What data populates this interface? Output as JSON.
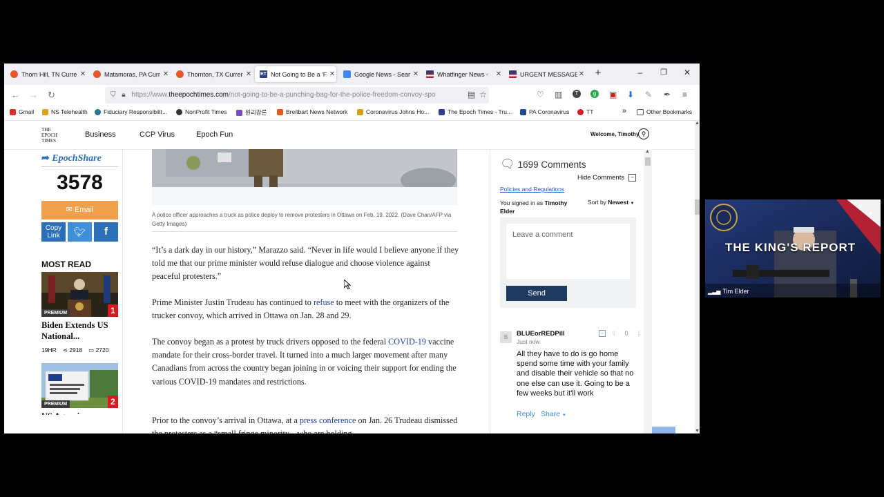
{
  "browser": {
    "tabs": [
      {
        "title": "Thorn Hill, TN Curre",
        "icon": "weather-sun-icon",
        "color": "#e8562a",
        "active": false
      },
      {
        "title": "Matamoras, PA Curr",
        "icon": "weather-sun-icon",
        "color": "#e8562a",
        "active": false
      },
      {
        "title": "Thornton, TX Currer",
        "icon": "weather-sun-icon",
        "color": "#e8562a",
        "active": false
      },
      {
        "title": "Not Going to Be a 'F",
        "icon": "epoch-times-icon",
        "color": "#2a3f8f",
        "active": true
      },
      {
        "title": "Google News - Sear",
        "icon": "google-news-icon",
        "color": "#4285f4",
        "active": false
      },
      {
        "title": "Whatfinger News - ",
        "icon": "us-flag-icon",
        "color": "#b22234",
        "active": false
      },
      {
        "title": "URGENT MESSAGE T",
        "icon": "us-flag-icon",
        "color": "#b22234",
        "active": false
      }
    ],
    "url_prefix": "https://www.",
    "url_domain": "theepochtimes.com",
    "url_path": "/not-going-to-be-a-punching-bag-for-the-police-freedom-convoy-spo",
    "bookmarks": [
      {
        "label": "Gmail",
        "color": "#d93025"
      },
      {
        "label": "NS Telehealth",
        "color": "#e0a020"
      },
      {
        "label": "Fiduciary Responsibilit...",
        "color": "#21759b"
      },
      {
        "label": "NonProfit Times",
        "color": "#333333"
      },
      {
        "label": "원리강론",
        "color": "#7b4ac2"
      },
      {
        "label": "Breitbart News Network",
        "color": "#e05a1a"
      },
      {
        "label": "Coronavirus Johns Ho...",
        "color": "#d4a017"
      },
      {
        "label": "The Epoch Times - Tru...",
        "color": "#2a3f8f"
      },
      {
        "label": "PA Coronavirus",
        "color": "#1e4b8f"
      },
      {
        "label": "TT",
        "color": "#d71920"
      }
    ],
    "other_bookmarks": "Other Bookmarks"
  },
  "site": {
    "logo": [
      "THE",
      "EPOCH",
      "TIMES"
    ],
    "nav": [
      "Business",
      "CCP Virus",
      "Epoch Fun"
    ],
    "welcome": "Welcome, Timothy"
  },
  "share": {
    "brand": "EpochShare",
    "count": "3578",
    "email": "Email",
    "copy_link": "Copy Link"
  },
  "most_read": {
    "heading": "MOST READ",
    "items": [
      {
        "badge": "PREMIUM",
        "rank": "1",
        "title": "Biden Extends US National...",
        "time": "19HR",
        "shares": "2918",
        "comments": "2720"
      },
      {
        "badge": "PREMIUM",
        "rank": "2",
        "title": "US Agencies..."
      }
    ]
  },
  "article": {
    "caption": "A police officer approaches a truck as police deploy to remove protesters in Ottawa on Feb. 19, 2022. (Dave Chan/AFP via Getty Images)",
    "p1": "“It’s a dark day in our history,” Marazzo said. “Never in life would I believe anyone if they told me that our prime minister would refuse dialogue and choose violence against peaceful protesters.”",
    "p2_a": "Prime Minister Justin Trudeau has continued to ",
    "p2_link": "refuse",
    "p2_b": " to meet with the organizers of the trucker convoy, which arrived in Ottawa on Jan. 28 and 29.",
    "p3_a": "The convoy began as a protest by truck drivers opposed to the federal ",
    "p3_link": "COVID-19",
    "p3_b": " vaccine mandate for their cross-border travel. It turned into a much larger movement after many Canadians from across the country began joining in or voicing their support for ending the various COVID-19 mandates and restrictions.",
    "p4_a": "Prior to the convoy’s arrival in Ottawa, at a ",
    "p4_link": "press conference",
    "p4_b": " on Jan. 26 Trudeau dismissed the protesters as a “small fringe minority... who are holding"
  },
  "comments": {
    "count_label": "1699 Comments",
    "hide": "Hide Comments",
    "policies": "Policies and Regulations",
    "signed_in_prefix": "You signed in as ",
    "signed_in_user": "Timothy Elder",
    "sort_prefix": "Sort by ",
    "sort_value": "Newest",
    "placeholder": "Leave a comment",
    "send": "Send",
    "first": {
      "avatar": "B",
      "user": "BLUEorREDPill",
      "time": "Just now",
      "votes": "0",
      "text": "All they have to do is go home spend some time with your family and disable their vehicle so that no one else can use it. Going to be a few weeks but it'll work",
      "reply": "Reply",
      "share": "Share"
    }
  },
  "webcam": {
    "show_title": "THE KING'S REPORT",
    "name": "Tim Elder"
  },
  "colors": {
    "accent_blue": "#2a6fb8",
    "email_orange": "#f0a04b",
    "send_navy": "#1e3a5f",
    "link_blue": "#1c3fb4",
    "rank_red": "#d71920"
  }
}
